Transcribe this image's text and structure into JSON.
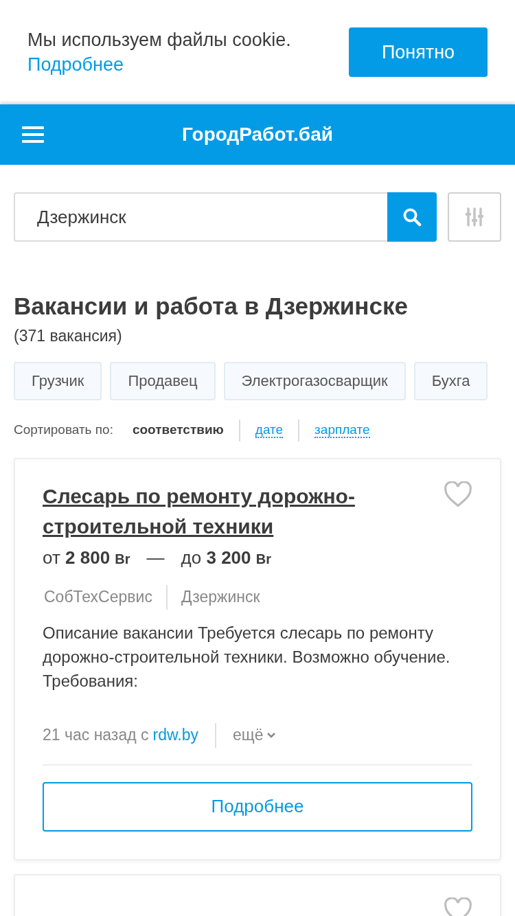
{
  "cookie_banner": {
    "text": "Мы используем файлы cookie.",
    "link": "Подробнее",
    "button": "Понятно"
  },
  "header": {
    "title": "ГородРабот.бай"
  },
  "search": {
    "value": "Дзержинск"
  },
  "heading": {
    "title": "Вакансии и работа в Дзержинске",
    "count": "(371 вакансия)"
  },
  "tags": [
    "Грузчик",
    "Продавец",
    "Электрогазосварщик",
    "Бухга"
  ],
  "sort": {
    "label": "Сортировать по:",
    "options": [
      {
        "label": "соответствию",
        "selected": true
      },
      {
        "label": "дате",
        "selected": false
      },
      {
        "label": "зарплате",
        "selected": false
      }
    ]
  },
  "vacancies": [
    {
      "title": "Слесарь по ремонту дорожно-строительной техники",
      "favorite": false,
      "salary_from_prefix": "от",
      "salary_from": "2 800",
      "salary_to_prefix": "до",
      "salary_to": "3 200",
      "currency_from": "Br",
      "currency_to": "Br",
      "dash": "—",
      "company": "СобТехСервис",
      "city": "Дзержинск",
      "description": "Описание вакансии Требуется слесарь по ремонту дорожно-строительной техники. Возможно обучение. Требования:",
      "posted": "21 час назад с",
      "source": "rdw.by",
      "more": "ещё",
      "button": "Подробнее"
    },
    {
      "favorite": false
    }
  ]
}
